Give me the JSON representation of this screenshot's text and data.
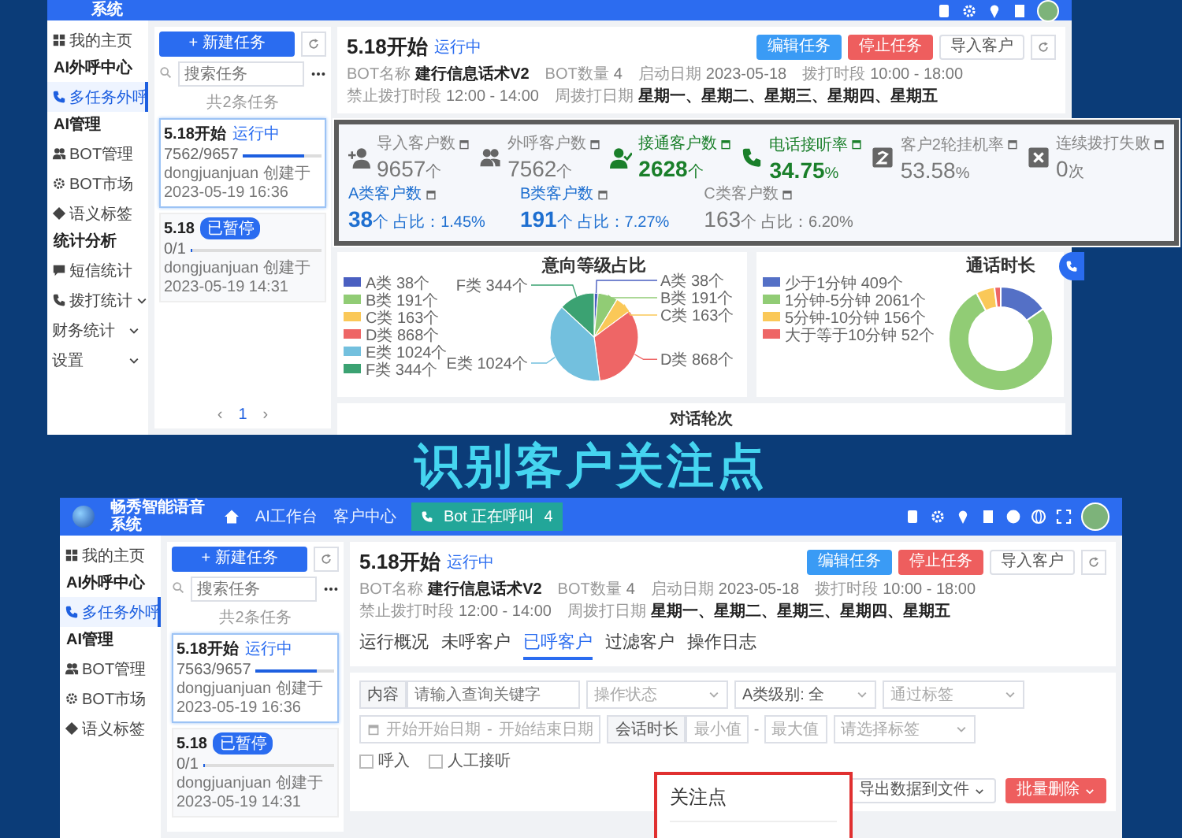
{
  "top_window": {
    "header": {
      "title": "系统"
    },
    "sidebar": [
      {
        "kind": "item",
        "label": "我的主页",
        "selected": false
      },
      {
        "kind": "group",
        "label": "AI外呼中心"
      },
      {
        "kind": "item",
        "label": "多任务外呼",
        "selected": true
      },
      {
        "kind": "group",
        "label": "AI管理"
      },
      {
        "kind": "item",
        "label": "BOT管理",
        "selected": false
      },
      {
        "kind": "item",
        "label": "BOT市场",
        "selected": false
      },
      {
        "kind": "item",
        "label": "语义标签",
        "selected": false
      },
      {
        "kind": "group",
        "label": "统计分析"
      },
      {
        "kind": "item",
        "label": "短信统计",
        "selected": false
      },
      {
        "kind": "submenu",
        "label": "拨打统计",
        "selected": false
      },
      {
        "kind": "submenu",
        "label": "财务统计",
        "selected": false
      },
      {
        "kind": "submenu",
        "label": "设置",
        "selected": false
      }
    ],
    "task_panel": {
      "new_button": "+ 新建任务",
      "search_placeholder": "搜索任务",
      "count": "共2条任务",
      "tasks": [
        {
          "name": "5.18开始",
          "status": "运行中",
          "kind": "running",
          "progress": "7562/9657",
          "level": 0.78,
          "creator": "dongjuanjuan 创建于 2023-05-19 16:36",
          "selected": true
        },
        {
          "name": "5.18",
          "status": "已暂停",
          "kind": "paused",
          "progress": "0/1",
          "level": 0,
          "creator": "dongjuanjuan 创建于 2023-05-19 14:31",
          "selected": false
        }
      ],
      "pagination": {
        "prev": "‹",
        "page": "1",
        "next": "›"
      }
    },
    "task_detail": {
      "title": "5.18开始",
      "status": "运行中",
      "info": [
        {
          "label": "BOT名称",
          "value": "建行信息话术V2",
          "emphasis": true
        },
        {
          "label": "BOT数量",
          "value": "4",
          "emphasis": false
        },
        {
          "label": "启动日期",
          "value": "2023-05-18",
          "emphasis": false
        },
        {
          "label": "拨打时段",
          "value": "10:00 - 18:00",
          "emphasis": false
        },
        {
          "label": "禁止拨打时段",
          "value": "12:00 - 14:00",
          "emphasis": false
        },
        {
          "label": "周拨打日期",
          "value": "星期一、星期二、星期三、星期四、星期五",
          "emphasis": true
        }
      ],
      "buttons": [
        {
          "label": "编辑任务",
          "kind": "primary"
        },
        {
          "label": "停止任务",
          "kind": "danger"
        },
        {
          "label": "导入客户",
          "kind": "default"
        }
      ]
    },
    "intent_chart": {
      "chart_data": {
        "type": "pie",
        "title": "意向等级占比",
        "legend": "left",
        "categories": [
          "A类 38个",
          "B类 191个",
          "C类 163个",
          "D类 868个",
          "E类 1024个",
          "F类 344个"
        ],
        "values": [
          38,
          191,
          163,
          868,
          1024,
          344
        ],
        "value_labels": [
          "A类 38个",
          "B类 191个",
          "C类 163个",
          "D类 868个",
          "E类 1024个",
          "F类 344个"
        ]
      }
    },
    "duration_chart": {
      "chart_data": {
        "type": "donut",
        "title": "通话时长",
        "legend": "left",
        "categories": [
          "少于1分钟 409个",
          "1分钟-5分钟 2061个",
          "5分钟-10分钟 156个",
          "大于等于10分钟 52个"
        ],
        "values": [
          409,
          2061,
          156,
          52
        ]
      }
    },
    "rounds_chart": {
      "title": "对话轮次"
    }
  },
  "stats_callout": {
    "primary": [
      {
        "label": "导入客户数",
        "value": "9657",
        "unit": "个",
        "kind": "neutral"
      },
      {
        "label": "外呼客户数",
        "value": "7562",
        "unit": "个",
        "kind": "neutral"
      },
      {
        "label": "接通客户数",
        "value": "2628",
        "unit": "个",
        "kind": "positive"
      },
      {
        "label": "电话接听率",
        "value": "34.75",
        "unit": "%",
        "kind": "positive"
      },
      {
        "label": "客户2轮挂机率",
        "value": "53.58",
        "unit": "%",
        "kind": "neutral"
      },
      {
        "label": "连续拨打失败",
        "value": "0",
        "unit": "次",
        "kind": "neutral"
      }
    ],
    "secondary": [
      {
        "label": "A类客户数",
        "value": "38",
        "unit": "个",
        "ratio": "占比：1.45%",
        "kind": "accent"
      },
      {
        "label": "B类客户数",
        "value": "191",
        "unit": "个",
        "ratio": "占比：7.27%",
        "kind": "accent"
      },
      {
        "label": "C类客户数",
        "value": "163",
        "unit": "个",
        "ratio": "占比：6.20%",
        "kind": "neutral"
      }
    ]
  },
  "headline": "识别客户关注点",
  "bottom_window": {
    "header": {
      "title": "畅秀智能语音系统",
      "nav": [
        "AI工作台",
        "客户中心"
      ],
      "call_badge": {
        "label": "Bot 正在呼叫",
        "count": "4"
      }
    },
    "sidebar": [
      {
        "kind": "item",
        "label": "我的主页",
        "selected": false
      },
      {
        "kind": "group",
        "label": "AI外呼中心"
      },
      {
        "kind": "item",
        "label": "多任务外呼",
        "selected": true
      },
      {
        "kind": "group",
        "label": "AI管理"
      },
      {
        "kind": "item",
        "label": "BOT管理",
        "selected": false
      },
      {
        "kind": "item",
        "label": "BOT市场",
        "selected": false
      },
      {
        "kind": "item",
        "label": "语义标签",
        "selected": false
      }
    ],
    "task_panel": {
      "new_button": "+ 新建任务",
      "search_placeholder": "搜索任务",
      "count": "共2条任务",
      "tasks": [
        {
          "name": "5.18开始",
          "status": "运行中",
          "kind": "running",
          "progress": "7563/9657",
          "level": 0.78,
          "creator": "dongjuanjuan 创建于 2023-05-19 16:36",
          "selected": true
        },
        {
          "name": "5.18",
          "status": "已暂停",
          "kind": "paused",
          "progress": "0/1",
          "level": 0,
          "creator": "dongjuanjuan 创建于 2023-05-19 14:31",
          "selected": false
        }
      ]
    },
    "task_detail": {
      "title": "5.18开始",
      "status": "运行中",
      "info": [
        {
          "label": "BOT名称",
          "value": "建行信息话术V2",
          "emphasis": true
        },
        {
          "label": "BOT数量",
          "value": "4",
          "emphasis": false
        },
        {
          "label": "启动日期",
          "value": "2023-05-18",
          "emphasis": false
        },
        {
          "label": "拨打时段",
          "value": "10:00 - 18:00",
          "emphasis": false
        },
        {
          "label": "禁止拨打时段",
          "value": "12:00 - 14:00",
          "emphasis": false
        },
        {
          "label": "周拨打日期",
          "value": "星期一、星期二、星期三、星期四、星期五",
          "emphasis": true
        }
      ],
      "buttons": [
        {
          "label": "编辑任务",
          "kind": "primary"
        },
        {
          "label": "停止任务",
          "kind": "danger"
        },
        {
          "label": "导入客户",
          "kind": "default"
        }
      ],
      "tabs": [
        {
          "label": "运行概况",
          "selected": false
        },
        {
          "label": "未呼客户",
          "selected": false
        },
        {
          "label": "已呼客户",
          "selected": true
        },
        {
          "label": "过滤客户",
          "selected": false
        },
        {
          "label": "操作日志",
          "selected": false
        }
      ]
    },
    "filters": {
      "row_1": [
        {
          "kind": "input",
          "label": "内容",
          "placeholder": "请输入查询关键字"
        },
        {
          "kind": "select",
          "placeholder": "操作状态"
        },
        {
          "kind": "select",
          "value": "A类级别: 全"
        },
        {
          "kind": "select",
          "placeholder": "通过标签"
        }
      ],
      "row_2": [
        {
          "kind": "date_range",
          "start_placeholder": "开始开始日期",
          "separator": "-",
          "end_placeholder": "开始结束日期"
        },
        {
          "kind": "range",
          "label": "会话时长",
          "min_placeholder": "最小值",
          "separator": "-",
          "max_placeholder": "最大值"
        },
        {
          "kind": "select",
          "placeholder": "请选择标签"
        }
      ],
      "checkboxes": [
        {
          "label": "呼入",
          "checked": false
        },
        {
          "label": "人工接听",
          "checked": false
        }
      ],
      "actions": [
        {
          "label": "导出数据到文件",
          "kind": "default"
        },
        {
          "label": "批量删除",
          "kind": "danger"
        }
      ]
    },
    "popup": {
      "title": "关注点"
    }
  }
}
